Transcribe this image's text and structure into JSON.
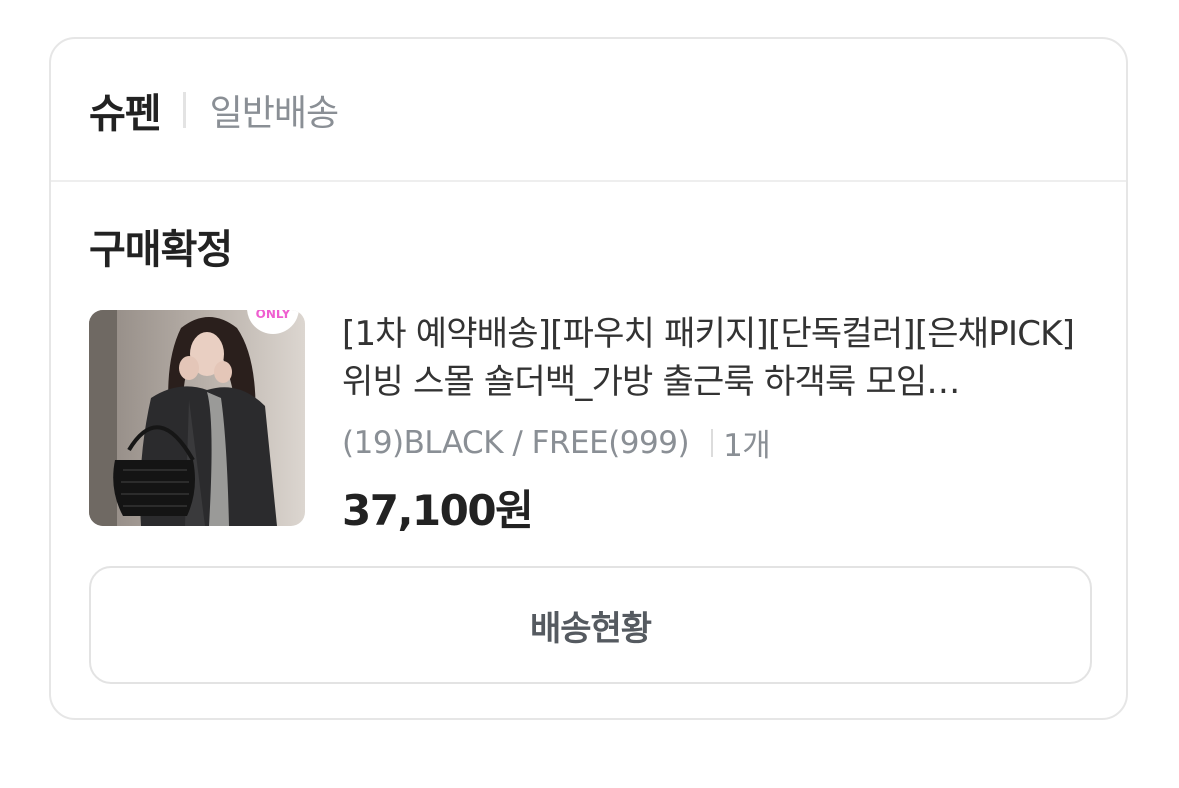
{
  "header": {
    "store_name": "슈펜",
    "shipping_type": "일반배송"
  },
  "order": {
    "status": "구매확정"
  },
  "product": {
    "thumbnail_badge": "ONLY",
    "title": "[1차 예약배송][파우치 패키지][단독컬러][은채PICK] 위빙 스몰 숄더백_가방 출근룩 하객룩 모임…",
    "option": "(19)BLACK / FREE(999)",
    "quantity": "1개",
    "price": "37,100원"
  },
  "actions": {
    "delivery_status_label": "배송현황"
  }
}
